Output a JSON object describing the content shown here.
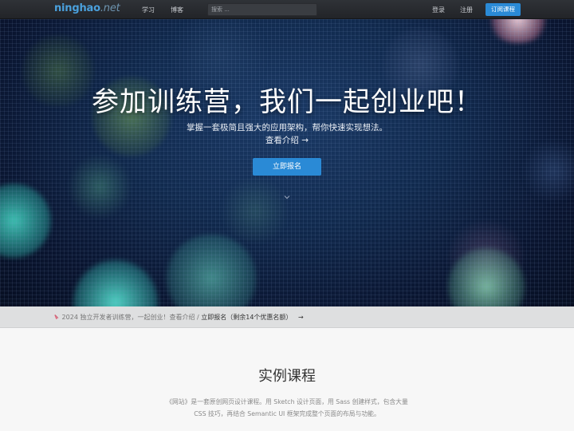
{
  "nav": {
    "logo": "ninghao",
    "logo_tld": ".net",
    "links": [
      "学习",
      "博客"
    ],
    "search_placeholder": "搜索 ...",
    "login": "登录",
    "register": "注册",
    "subscribe": "订阅课程"
  },
  "hero": {
    "title": "参加训练营，我们一起创业吧！",
    "subtitle": "掌握一套极简且强大的应用架构，帮你快速实现想法。",
    "more": "查看介绍 →",
    "cta": "立即报名",
    "down_icon": "chevron-down-icon"
  },
  "notice": {
    "icon": "megaphone-icon",
    "text": "2024 独立开发者训练营，一起创业！查看介绍 / ",
    "link": "立即报名（剩余14个优惠名额）",
    "arrow": "→"
  },
  "section": {
    "title": "实例课程",
    "description": "《网站》是一套原创网页设计课程。用 Sketch 设计页面，用 Sass 创建样式，包含大量 CSS 技巧，再结合 Semantic UI 框架完成整个页面的布局与功能。"
  },
  "colors": {
    "accent": "#2a8ad6",
    "navbar": "#26292d",
    "hero_bg": "#0d1e3e"
  }
}
